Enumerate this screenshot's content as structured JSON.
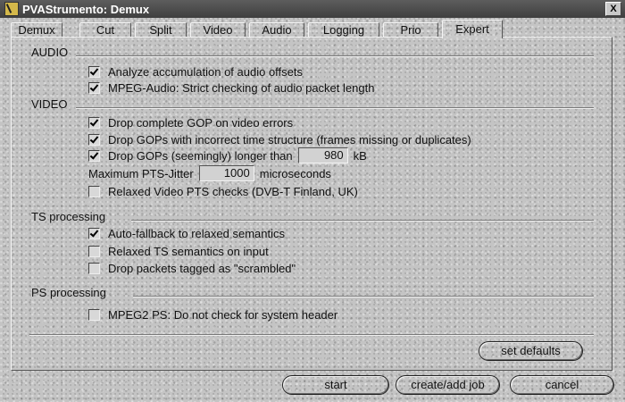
{
  "window": {
    "title": "PVAStrumento: Demux",
    "close_label": "X"
  },
  "tabs": [
    "Demux",
    "Cut",
    "Split",
    "Video",
    "Audio",
    "Logging",
    "Prio",
    "Expert"
  ],
  "active_tab": "Expert",
  "audio": {
    "title": "AUDIO",
    "options": [
      {
        "label": "Analyze accumulation of audio offsets",
        "checked": true
      },
      {
        "label": "MPEG-Audio: Strict checking of audio packet length",
        "checked": true
      }
    ]
  },
  "video": {
    "title": "VIDEO",
    "drop_complete_gop": {
      "label": "Drop complete GOP on video errors",
      "checked": true
    },
    "drop_incorrect_time": {
      "label": "Drop GOPs with incorrect time structure (frames missing or duplicates)",
      "checked": true
    },
    "drop_longer": {
      "label": "Drop GOPs (seemingly) longer than",
      "checked": true,
      "value": "980",
      "unit": "kB"
    },
    "pts_jitter": {
      "label": "Maximum PTS-Jitter",
      "value": "1000",
      "unit": "microseconds"
    },
    "relaxed_pts": {
      "label": "Relaxed  Video PTS  checks (DVB-T Finland, UK)",
      "checked": false
    }
  },
  "ts": {
    "title": "TS processing",
    "options": [
      {
        "label": "Auto-fallback to relaxed semantics",
        "checked": true
      },
      {
        "label": "Relaxed TS semantics on input",
        "checked": false
      },
      {
        "label": "Drop packets tagged as \"scrambled\"",
        "checked": false
      }
    ]
  },
  "ps": {
    "title": "PS processing",
    "options": [
      {
        "label": "MPEG2 PS: Do not check for system header",
        "checked": false
      }
    ]
  },
  "buttons": {
    "set_defaults": "set defaults",
    "start": "start",
    "create_add_job": "create/add job",
    "cancel": "cancel"
  }
}
